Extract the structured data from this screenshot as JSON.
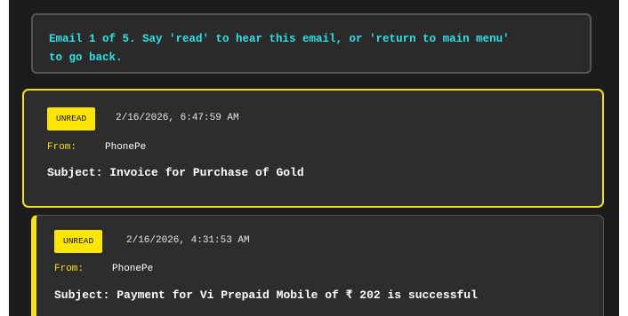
{
  "prompt": {
    "line1": "Email 1 of 5. Say 'read' to hear this email, or 'return to main menu'",
    "line2": "to go back."
  },
  "emails": [
    {
      "status": "UNREAD",
      "timestamp": "2/16/2026, 6:47:59 AM",
      "from_label": "From:",
      "from": "PhonePe",
      "subject": "Subject: Invoice for Purchase of Gold",
      "selected": true
    },
    {
      "status": "UNREAD",
      "timestamp": "2/16/2026, 4:31:53 AM",
      "from_label": "From:",
      "from": "PhonePe",
      "subject": "Subject: Payment for Vi Prepaid Mobile of ₹ 202 is successful",
      "selected": false
    }
  ],
  "colors": {
    "accent_yellow": "#f5e01c",
    "prompt_cyan": "#2fe0e6",
    "card_bg": "#2d2d2d",
    "frame_bg": "#1c1c1c"
  }
}
